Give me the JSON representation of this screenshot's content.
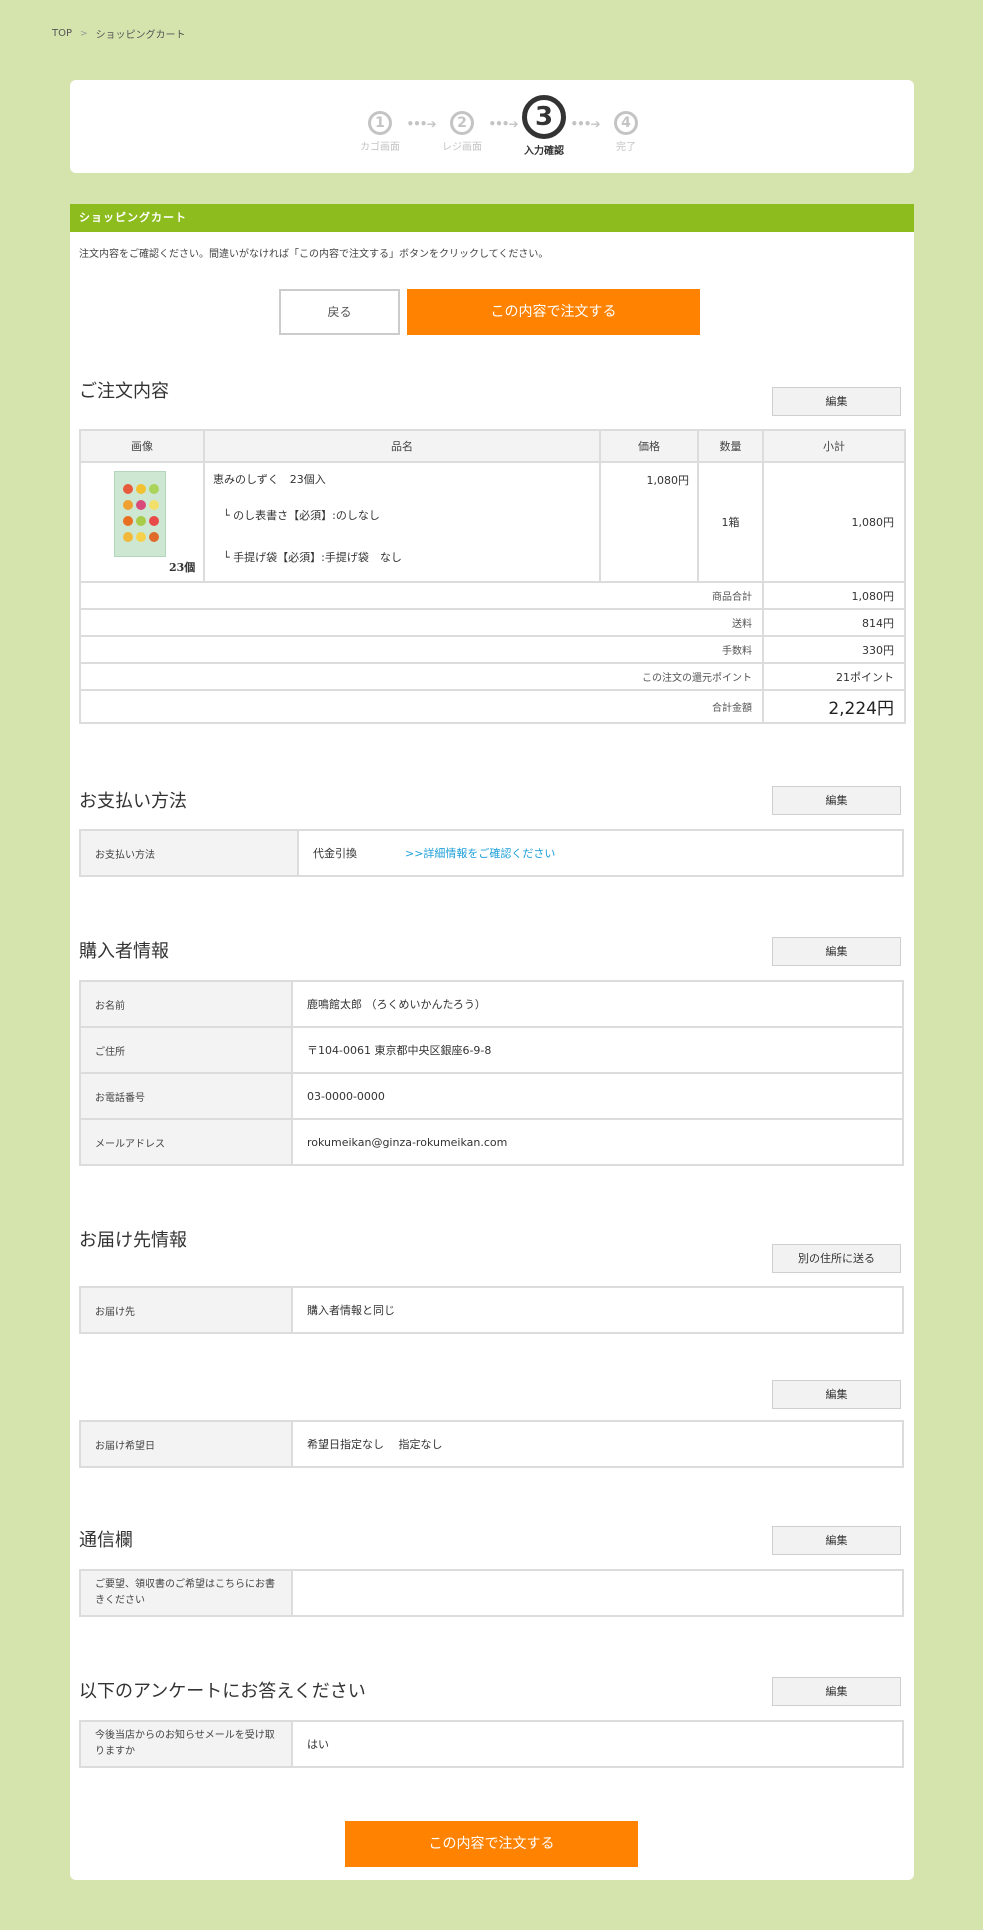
{
  "breadcrumb": {
    "top": "TOP",
    "sep": ">",
    "current": "ショッピングカート"
  },
  "steps": [
    {
      "num": "1",
      "label": "カゴ画面"
    },
    {
      "num": "2",
      "label": "レジ画面"
    },
    {
      "num": "3",
      "label": "入力確認"
    },
    {
      "num": "4",
      "label": "完了"
    }
  ],
  "step_arrow": "•••➔",
  "cart": {
    "header": "ショッピングカート",
    "intro": "注文内容をご確認ください。間違いがなければ「この内容で注文する」ボタンをクリックしてください。",
    "back_label": "戻る",
    "order_label": "この内容で注文する"
  },
  "edit_label": "編集",
  "order_section": {
    "title": "ご注文内容",
    "headers": [
      "画像",
      "品名",
      "価格",
      "数量",
      "小計"
    ],
    "item": {
      "name": "恵みのしずく　23個入",
      "option1": "└ のし表書さ【必須】:のしなし",
      "option2": "└ 手提げ袋【必須】:手提げ袋　なし",
      "price": "1,080円",
      "qty": "1箱",
      "subtotal": "1,080円",
      "image_count": "23個"
    },
    "summary": [
      {
        "label": "商品合計",
        "value": "1,080円"
      },
      {
        "label": "送料",
        "value": "814円"
      },
      {
        "label": "手数料",
        "value": "330円"
      },
      {
        "label": "この注文の還元ポイント",
        "value": "21ポイント"
      }
    ],
    "total_label": "合計金額",
    "total_value": "2,224円"
  },
  "payment": {
    "title": "お支払い方法",
    "label": "お支払い方法",
    "value": "代金引換",
    "link": ">>詳細情報をご確認ください"
  },
  "buyer": {
    "title": "購入者情報",
    "rows": [
      {
        "label": "お名前",
        "value": "鹿鳴館太郎 （ろくめいかんたろう）"
      },
      {
        "label": "ご住所",
        "value": "〒104-0061  東京都中央区銀座6-9-8"
      },
      {
        "label": "お電話番号",
        "value": "03-0000-0000"
      },
      {
        "label": "メールアドレス",
        "value": "rokumeikan@ginza-rokumeikan.com"
      }
    ]
  },
  "delivery": {
    "title": "お届け先情報",
    "other_address_label": "別の住所に送る",
    "dest_label": "お届け先",
    "dest_value": "購入者情報と同じ",
    "date_label": "お届け希望日",
    "date_value": "希望日指定なし　 指定なし"
  },
  "message": {
    "title": "通信欄",
    "label": "ご要望、領収書のご希望はこちらにお書きください",
    "value": ""
  },
  "survey": {
    "title": "以下のアンケートにお答えください",
    "label": "今後当店からのお知らせメールを受け取りますか",
    "value": "はい"
  },
  "colors": {
    "background": "#d5e4ad",
    "header_green": "#8dbc1f",
    "order_orange": "#ff8200",
    "link_blue": "#1ea0d8"
  }
}
